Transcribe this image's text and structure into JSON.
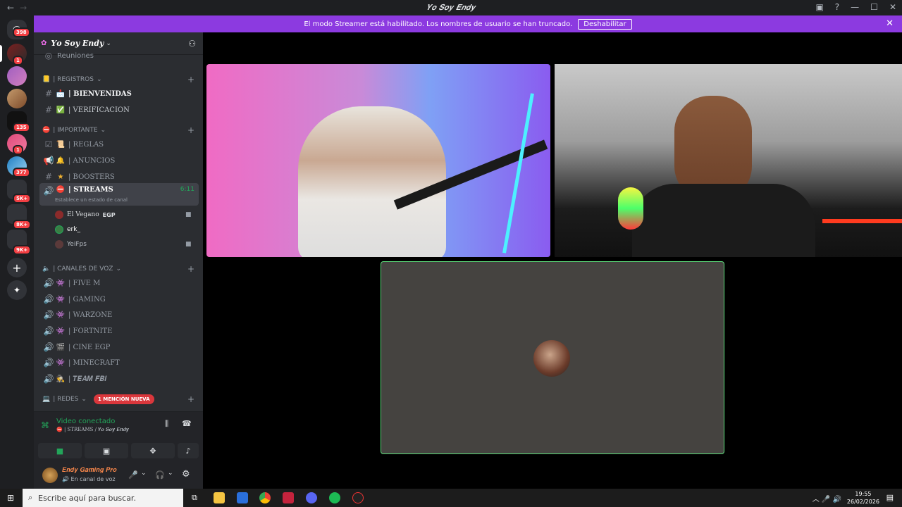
{
  "window": {
    "title": "𝒀𝒐 𝑺𝒐𝒚 𝑬𝒏𝒅𝒚",
    "back": "←",
    "forward": "→",
    "minimize": "—",
    "maximize": "☐",
    "close": "✕"
  },
  "banner": {
    "text": "El modo Streamer está habilitado. Los nombres de usuario se han truncado.",
    "button": "Deshabilitar"
  },
  "servers": {
    "badges": [
      "398",
      "1",
      "135",
      "1",
      "377",
      "5K+",
      "8K+",
      "9K+"
    ]
  },
  "sidebar": {
    "server_name": "𝒀𝒐 𝑺𝒐𝒚 𝑬𝒏𝒅𝒚",
    "top_item": "Reuniones",
    "categories": [
      {
        "label": "| REGISTROS"
      },
      {
        "label": "| IMPORTANTE"
      },
      {
        "label": "| CANALES DE VOZ"
      },
      {
        "label": "| REDES"
      }
    ],
    "mention_badge": "1 MENCIÓN NUEVA",
    "channels": [
      {
        "label": "| BIENVENIDAS"
      },
      {
        "label": "| VERIFICACION"
      },
      {
        "label": "| REGLAS"
      },
      {
        "label": "| ANUNCIOS"
      },
      {
        "label": "| BOOSTERS"
      },
      {
        "label": "| STREAMS",
        "timer": "6:11",
        "status": "Establece un estado de canal"
      },
      {
        "label": "| FIVE M"
      },
      {
        "label": "|  GAMING"
      },
      {
        "label": "| WARZONE"
      },
      {
        "label": "| FORTNITE"
      },
      {
        "label": "| CINE EGP"
      },
      {
        "label": "| MINECRAFT"
      },
      {
        "label": "| 𝑻𝑬𝑨𝑴 𝑭𝑩𝑰"
      }
    ],
    "voice_users": [
      {
        "name": "El Vegano",
        "tag": "EGP"
      },
      {
        "name": "erk_"
      },
      {
        "name": "YeiFps"
      }
    ]
  },
  "voice_panel": {
    "status": "Video conectado",
    "channel": "| STREAMS / 𝒀𝒐 𝑺𝒐𝒚 𝑬𝒏𝒅𝒚"
  },
  "user_panel": {
    "name": "𝑬𝒏𝒅𝒚 𝑮𝒂𝒎𝒊𝒏𝒈 𝑷𝒓𝒐",
    "status": "En canal de voz"
  },
  "taskbar": {
    "search_placeholder": "Escribe aquí para buscar.",
    "time": "19:55",
    "date": "26/02/2026"
  },
  "colors": {
    "banner": "#8c3ae0",
    "sidebar": "#2b2d31",
    "server_rail": "#1e1f22",
    "accent_green": "#23a55a",
    "mention_red": "#da373c"
  }
}
